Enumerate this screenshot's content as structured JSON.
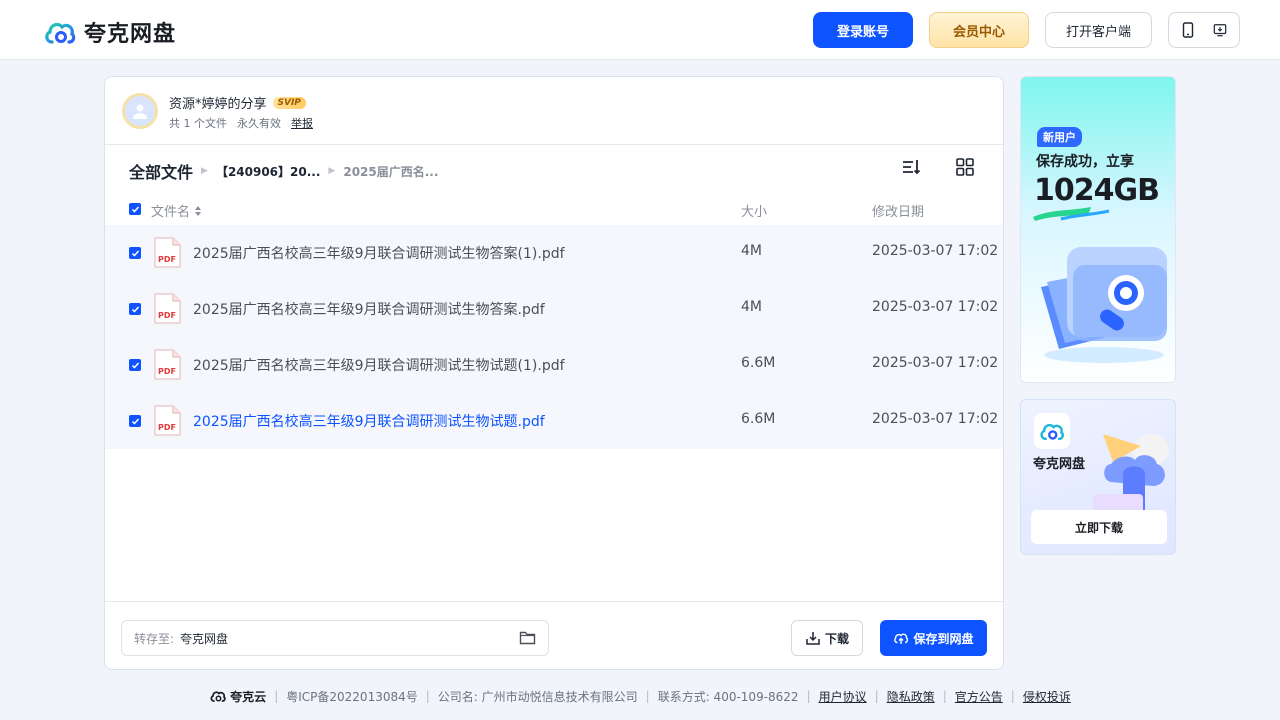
{
  "header": {
    "brand": "夸克网盘",
    "login_label": "登录账号",
    "vip_label": "会员中心",
    "client_label": "打开客户端"
  },
  "share": {
    "title": "资源*婷婷的分享",
    "badge": "SVIP",
    "file_count": "共 1 个文件",
    "validity": "永久有效",
    "report": "举报"
  },
  "breadcrumb": {
    "root": "全部文件",
    "items": [
      "【240906】20...",
      "2025届广西名..."
    ]
  },
  "table": {
    "columns": [
      "文件名",
      "大小",
      "修改日期"
    ],
    "rows": [
      {
        "name": "2025届广西名校高三年级9月联合调研测试生物答案(1).pdf",
        "size": "4M",
        "date": "2025-03-07 17:02",
        "icon": "pdf-file-icon",
        "checked": true
      },
      {
        "name": "2025届广西名校高三年级9月联合调研测试生物答案.pdf",
        "size": "4M",
        "date": "2025-03-07 17:02",
        "icon": "pdf-file-icon",
        "checked": true
      },
      {
        "name": "2025届广西名校高三年级9月联合调研测试生物试题(1).pdf",
        "size": "6.6M",
        "date": "2025-03-07 17:02",
        "icon": "pdf-file-icon",
        "checked": true
      },
      {
        "name": "2025届广西名校高三年级9月联合调研测试生物试题.pdf",
        "size": "6.6M",
        "date": "2025-03-07 17:02",
        "icon": "pdf-file-icon",
        "checked": true
      }
    ]
  },
  "bottom": {
    "save_to_label": "转存至:",
    "save_to_value": "夸克网盘",
    "download_label": "下载",
    "save_label": "保存到网盘"
  },
  "ads": {
    "ad1": {
      "tag": "新用户",
      "line1": "保存成功，立享",
      "line2": "1024GB"
    },
    "ad2": {
      "name": "夸克网盘",
      "button": "立即下载"
    }
  },
  "footer": {
    "brand": "夸克云",
    "icp": "粤ICP备2022013084号",
    "company": "公司名: 广州市动悦信息技术有限公司",
    "contact": "联系方式: 400-109-8622",
    "links": [
      "用户协议",
      "隐私政策",
      "官方公告",
      "侵权投诉"
    ]
  },
  "colors": {
    "primary": "#0d53ff",
    "vip": "#9a5a00",
    "link": "#0d53ff"
  }
}
